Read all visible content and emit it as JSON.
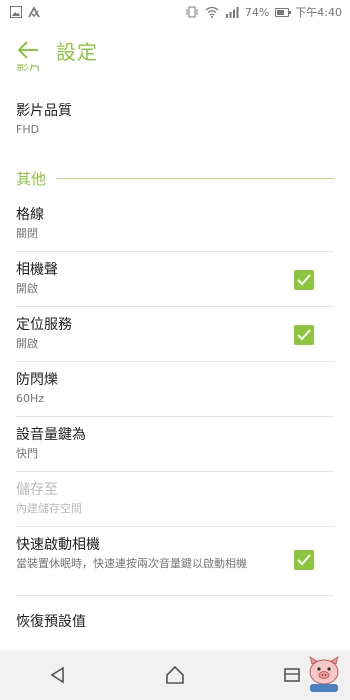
{
  "status_bar": {
    "battery_text": "74%",
    "battery_level": 0.74,
    "time": "下午4:40",
    "icons": [
      "image-icon",
      "download-check-icon",
      "vibrate-icon",
      "wifi-icon",
      "signal-icon"
    ]
  },
  "header": {
    "title": "設定",
    "back_icon": "arrow-left-icon"
  },
  "section_prev_clipped": "影片",
  "settings_top": [
    {
      "title": "影片品質",
      "value": "FHD"
    }
  ],
  "section_other": "其他",
  "settings": [
    {
      "title": "格線",
      "value": "關閉",
      "checkbox": false,
      "disabled": false
    },
    {
      "title": "相機聲",
      "value": "開啟",
      "checkbox": true,
      "checked": true,
      "disabled": false
    },
    {
      "title": "定位服務",
      "value": "開啟",
      "checkbox": true,
      "checked": true,
      "disabled": false
    },
    {
      "title": "防閃爍",
      "value": "60Hz",
      "checkbox": false,
      "disabled": false
    },
    {
      "title": "設音量鍵為",
      "value": "快門",
      "checkbox": false,
      "disabled": false
    },
    {
      "title": "儲存至",
      "value": "內建儲存空間",
      "checkbox": false,
      "disabled": true
    },
    {
      "title": "快速啟動相機",
      "value": "當裝置休眠時，快速連按兩次音量鍵以啟動相機",
      "checkbox": true,
      "checked": true,
      "disabled": false
    },
    {
      "title": "恢復預設值",
      "checkbox": false,
      "disabled": false
    }
  ],
  "nav": {
    "back_icon": "nav-back-icon",
    "home_icon": "nav-home-icon",
    "recents_icon": "nav-recents-icon"
  },
  "colors": {
    "accent": "#8cc63f",
    "divider": "#e4e4e4",
    "nav_background": "#f1f1f1"
  }
}
